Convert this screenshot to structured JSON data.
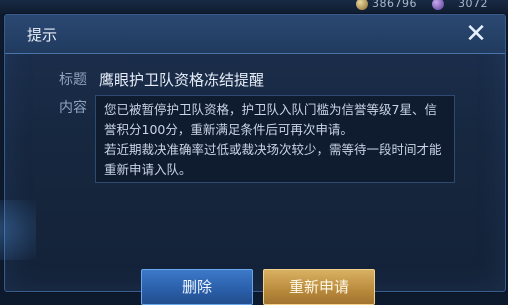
{
  "hud": {
    "gold_value": "386796",
    "diamond_value": "3072"
  },
  "dialog": {
    "title": "提示",
    "close_glyph": "✕",
    "heading_label": "标题",
    "heading_text": "鹰眼护卫队资格冻结提醒",
    "content_label": "内容",
    "content_line1": "您已被暂停护卫队资格，护卫队入队门槛为信誉等级7星、信誉积分100分，重新满足条件后可再次申请。",
    "content_line2": "若近期裁决准确率过低或裁决场次较少，需等待一段时间才能重新申请入队。"
  },
  "buttons": {
    "delete_label": "删除",
    "reapply_label": "重新申请"
  },
  "colors": {
    "dialog_bg": "#16273f",
    "title_bar": "#213b5f",
    "delete_button": "#2a5ea8",
    "reapply_button": "#b98a3c"
  }
}
